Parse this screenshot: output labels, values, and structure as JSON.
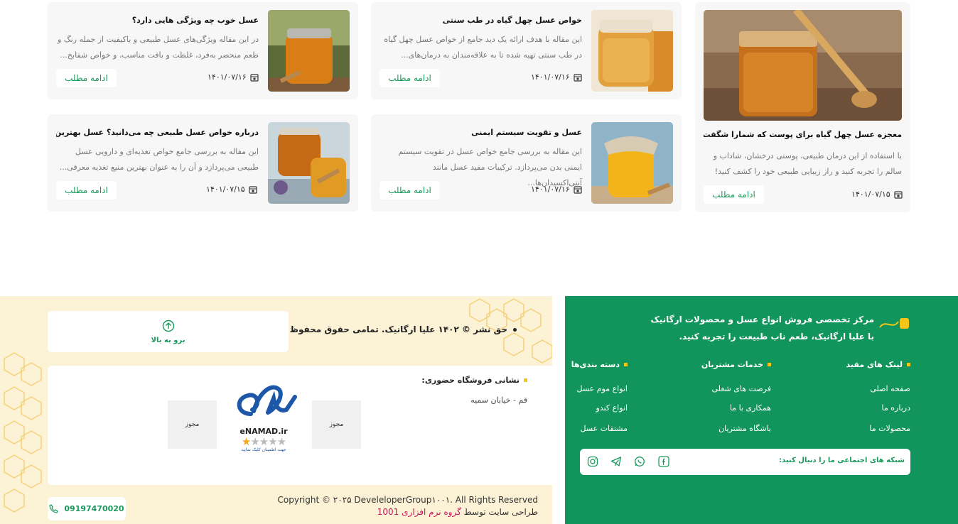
{
  "articles": [
    {
      "title": "معجزه عسل چهل گیاه برای پوست که شمارا شگفت زده می‌کند",
      "excerpt": "با استفاده از این درمان طبیعی، پوستی درخشان، شاداب و سالم را تجربه کنید و راز زیبایی طبیعی خود را کشف کنید!",
      "date": "۱۴۰۱/۰۷/۱۵",
      "more": "ادامه مطلب"
    },
    {
      "title": "خواص عسل چهل گیاه در طب سنتی",
      "excerpt": "این مقاله با هدف ارائه یک دید جامع از خواص عسل چهل گیاه در طب سنتی تهیه شده تا به علاقه‌مندان به درمان‌های...",
      "date": "۱۴۰۱/۰۷/۱۶",
      "more": "ادامه مطلب"
    },
    {
      "title": "عسل خوب چه ویژگی هایی دارد؟",
      "excerpt": "در این مقاله ویژگی‌های عسل طبیعی و باکیفیت از جمله رنگ و طعم منحصر به‌فرد، غلظت و بافت مناسب، و خواص شفابخ...",
      "date": "۱۴۰۱/۰۷/۱۶",
      "more": "ادامه مطلب"
    },
    {
      "title": "عسل و تقویت سیستم ایمنی",
      "excerpt": "این مقاله به بررسی جامع خواص عسل در تقویت سیستم ایمنی بدن می‌پردازد. ترکیبات مفید عسل مانند آنتی‌اکسیدان‌ها...",
      "date": "۱۴۰۱/۰۷/۱۶",
      "more": "ادامه مطلب"
    },
    {
      "title": "درباره خواص عسل طبیعی چه می‌دانید؟ عسل بهترین منبع تغذیه.",
      "excerpt": "این مقاله به بررسی جامع خواص تغذیه‌ای و دارویی عسل طبیعی می‌پردازد و آن را به عنوان بهترین منبع تغذیه معرفی...",
      "date": "۱۴۰۱/۰۷/۱۵",
      "more": "ادامه مطلب"
    }
  ],
  "footer": {
    "brand_heading": "مرکز تخصصی فروش انواع عسل و محصولات ارگانیک",
    "brand_sub": "با علیا ارگانیک، طعم ناب طبیعت را تجربه کنید.",
    "columns": [
      {
        "title": "لینک های مفید",
        "links": [
          "صفحه اصلی",
          "درباره ما",
          "محصولات ما"
        ]
      },
      {
        "title": "خدمات مشتریان",
        "links": [
          "فرصت های شغلی",
          "همکاری با ما",
          "باشگاه مشتریان"
        ]
      },
      {
        "title": "دسته بندی‌ها",
        "links": [
          "انواع موم عسل",
          "انواع کندو",
          "مشتقات عسل"
        ]
      }
    ],
    "social_label": "شبکه های اجتماعی ما را دنبال کنید:",
    "copyright_fa": "حق نشر © ۱۴۰۲ علیا ارگانیک. تمامی حقوق محفوظ است.",
    "back_to_top": "برو به بالا",
    "address_label": "نشانی فروشگاه حضوری:",
    "address": "قم - خیابان سمیه",
    "license_label": "مجوز",
    "enamad_text": "eNAMAD.ir",
    "enamad_caption": "جهت اطمینان کلیک نمایید",
    "copyright_en": "Copyright © ۲۰۲۵ DeveleloperGroup۱۰۰۱. All Rights Reserved",
    "designer_prefix": "طراحی سایت توسط",
    "designer_name": "گروه نرم افزاری 1001",
    "phone": "09197470020"
  },
  "colors": {
    "green": "#12955c",
    "accent_green": "#1a9a5c",
    "cream": "#fcf2d6",
    "yellow": "#f5c518",
    "pink": "#c2185b"
  }
}
